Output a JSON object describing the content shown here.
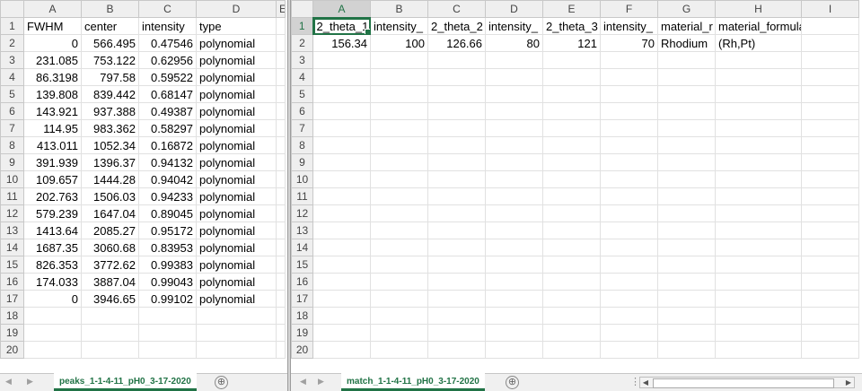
{
  "left_sheet": {
    "columns": [
      "A",
      "B",
      "C",
      "D",
      "E"
    ],
    "rows": [
      {
        "n": "1",
        "cells": [
          "FWHM",
          "center",
          "intensity",
          "type"
        ]
      },
      {
        "n": "2",
        "cells": [
          "0",
          "566.495",
          "0.47546",
          "polynomial"
        ]
      },
      {
        "n": "3",
        "cells": [
          "231.085",
          "753.122",
          "0.62956",
          "polynomial"
        ]
      },
      {
        "n": "4",
        "cells": [
          "86.3198",
          "797.58",
          "0.59522",
          "polynomial"
        ]
      },
      {
        "n": "5",
        "cells": [
          "139.808",
          "839.442",
          "0.68147",
          "polynomial"
        ]
      },
      {
        "n": "6",
        "cells": [
          "143.921",
          "937.388",
          "0.49387",
          "polynomial"
        ]
      },
      {
        "n": "7",
        "cells": [
          "114.95",
          "983.362",
          "0.58297",
          "polynomial"
        ]
      },
      {
        "n": "8",
        "cells": [
          "413.011",
          "1052.34",
          "0.16872",
          "polynomial"
        ]
      },
      {
        "n": "9",
        "cells": [
          "391.939",
          "1396.37",
          "0.94132",
          "polynomial"
        ]
      },
      {
        "n": "10",
        "cells": [
          "109.657",
          "1444.28",
          "0.94042",
          "polynomial"
        ]
      },
      {
        "n": "11",
        "cells": [
          "202.763",
          "1506.03",
          "0.94233",
          "polynomial"
        ]
      },
      {
        "n": "12",
        "cells": [
          "579.239",
          "1647.04",
          "0.89045",
          "polynomial"
        ]
      },
      {
        "n": "13",
        "cells": [
          "1413.64",
          "2085.27",
          "0.95172",
          "polynomial"
        ]
      },
      {
        "n": "14",
        "cells": [
          "1687.35",
          "3060.68",
          "0.83953",
          "polynomial"
        ]
      },
      {
        "n": "15",
        "cells": [
          "826.353",
          "3772.62",
          "0.99383",
          "polynomial"
        ]
      },
      {
        "n": "16",
        "cells": [
          "174.033",
          "3887.04",
          "0.99043",
          "polynomial"
        ]
      },
      {
        "n": "17",
        "cells": [
          "0",
          "3946.65",
          "0.99102",
          "polynomial"
        ]
      },
      {
        "n": "18",
        "cells": [
          "",
          "",
          "",
          ""
        ]
      },
      {
        "n": "19",
        "cells": [
          "",
          "",
          "",
          ""
        ]
      },
      {
        "n": "20",
        "cells": [
          "",
          "",
          "",
          ""
        ]
      }
    ],
    "tab_label": "peaks_1-1-4-11_pH0_3-17-2020"
  },
  "right_sheet": {
    "columns": [
      "A",
      "B",
      "C",
      "D",
      "E",
      "F",
      "G",
      "H",
      "I"
    ],
    "rows": [
      {
        "n": "1",
        "cells": [
          "2_theta_1",
          "intensity_",
          "2_theta_2",
          "intensity_",
          "2_theta_3",
          "intensity_",
          "material_r",
          "material_formula",
          ""
        ]
      },
      {
        "n": "2",
        "cells": [
          "156.34",
          "100",
          "126.66",
          "80",
          "121",
          "70",
          "Rhodium",
          "(Rh,Pt)",
          ""
        ]
      },
      {
        "n": "3",
        "cells": [
          "",
          "",
          "",
          "",
          "",
          "",
          "",
          "",
          ""
        ]
      },
      {
        "n": "4",
        "cells": [
          "",
          "",
          "",
          "",
          "",
          "",
          "",
          "",
          ""
        ]
      },
      {
        "n": "5",
        "cells": [
          "",
          "",
          "",
          "",
          "",
          "",
          "",
          "",
          ""
        ]
      },
      {
        "n": "6",
        "cells": [
          "",
          "",
          "",
          "",
          "",
          "",
          "",
          "",
          ""
        ]
      },
      {
        "n": "7",
        "cells": [
          "",
          "",
          "",
          "",
          "",
          "",
          "",
          "",
          ""
        ]
      },
      {
        "n": "8",
        "cells": [
          "",
          "",
          "",
          "",
          "",
          "",
          "",
          "",
          ""
        ]
      },
      {
        "n": "9",
        "cells": [
          "",
          "",
          "",
          "",
          "",
          "",
          "",
          "",
          ""
        ]
      },
      {
        "n": "10",
        "cells": [
          "",
          "",
          "",
          "",
          "",
          "",
          "",
          "",
          ""
        ]
      },
      {
        "n": "11",
        "cells": [
          "",
          "",
          "",
          "",
          "",
          "",
          "",
          "",
          ""
        ]
      },
      {
        "n": "12",
        "cells": [
          "",
          "",
          "",
          "",
          "",
          "",
          "",
          "",
          ""
        ]
      },
      {
        "n": "13",
        "cells": [
          "",
          "",
          "",
          "",
          "",
          "",
          "",
          "",
          ""
        ]
      },
      {
        "n": "14",
        "cells": [
          "",
          "",
          "",
          "",
          "",
          "",
          "",
          "",
          ""
        ]
      },
      {
        "n": "15",
        "cells": [
          "",
          "",
          "",
          "",
          "",
          "",
          "",
          "",
          ""
        ]
      },
      {
        "n": "16",
        "cells": [
          "",
          "",
          "",
          "",
          "",
          "",
          "",
          "",
          ""
        ]
      },
      {
        "n": "17",
        "cells": [
          "",
          "",
          "",
          "",
          "",
          "",
          "",
          "",
          ""
        ]
      },
      {
        "n": "18",
        "cells": [
          "",
          "",
          "",
          "",
          "",
          "",
          "",
          "",
          ""
        ]
      },
      {
        "n": "19",
        "cells": [
          "",
          "",
          "",
          "",
          "",
          "",
          "",
          "",
          ""
        ]
      },
      {
        "n": "20",
        "cells": [
          "",
          "",
          "",
          "",
          "",
          "",
          "",
          "",
          ""
        ]
      }
    ],
    "tab_label": "match_1-1-4-11_pH0_3-17-2020",
    "active_cell": "A1"
  },
  "tabbar": {
    "add_sheet_symbol": "⊕",
    "ellipsis": "⋮",
    "nav_prev": "◀",
    "nav_next": "▶"
  },
  "colors": {
    "accent": "#217346",
    "header_bg": "#efefef",
    "gridline": "#e1e1e1"
  }
}
